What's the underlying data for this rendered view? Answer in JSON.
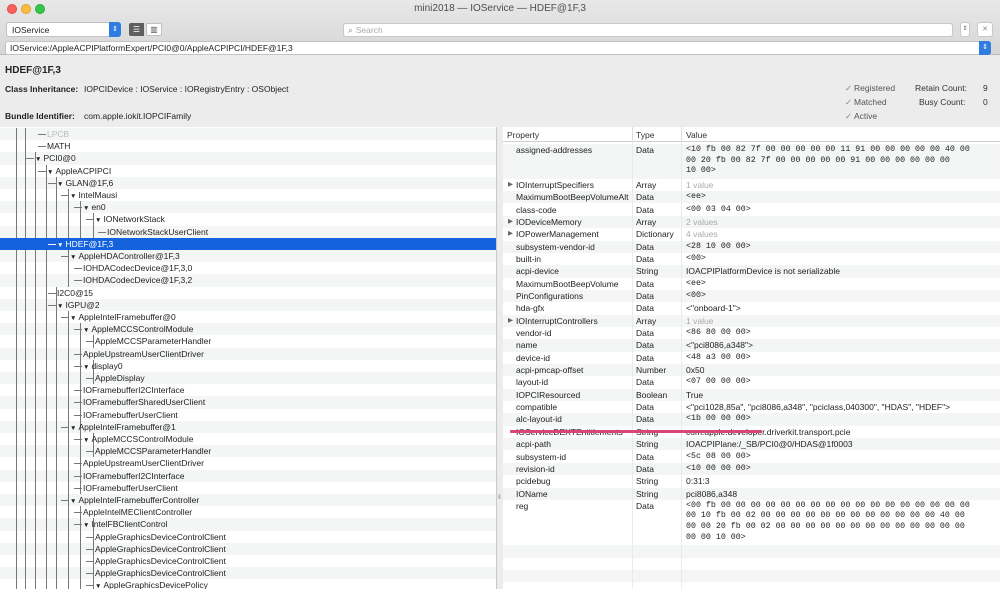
{
  "window": {
    "title": "mini2018 — IOService — HDEF@1F,3"
  },
  "toolbar": {
    "plane": "IOService",
    "search_placeholder": "Search",
    "search_icon": "magnifier-icon",
    "path": "IOService:/AppleACPIPlatformExpert/PCI0@0/AppleACPIPCI/HDEF@1F,3"
  },
  "info": {
    "name": "HDEF@1F,3",
    "class_label": "Class Inheritance:",
    "class_value": "IOPCIDevice : IOService : IORegistryEntry : OSObject",
    "bundle_label": "Bundle Identifier:",
    "bundle_value": "com.apple.iokit.IOPCIFamily",
    "registered": "Registered",
    "matched": "Matched",
    "active": "Active",
    "retain_label": "Retain Count:",
    "retain_value": "9",
    "busy_label": "Busy Count:",
    "busy_value": "0"
  },
  "tree": [
    {
      "label": "LPCB",
      "indent": 4,
      "arrow": "",
      "faded": true
    },
    {
      "label": "MATH",
      "indent": 4,
      "arrow": ""
    },
    {
      "label": "PCI0@0",
      "indent": 3,
      "arrow": "▼"
    },
    {
      "label": "AppleACPIPCI",
      "indent": 4,
      "arrow": "▼"
    },
    {
      "label": "GLAN@1F,6",
      "indent": 5,
      "arrow": "▼"
    },
    {
      "label": "IntelMausi",
      "indent": 6,
      "arrow": "▼"
    },
    {
      "label": "en0",
      "indent": 7,
      "arrow": "▼"
    },
    {
      "label": "IONetworkStack",
      "indent": 8,
      "arrow": "▼"
    },
    {
      "label": "IONetworkStackUserClient",
      "indent": 9,
      "arrow": ""
    },
    {
      "label": "HDEF@1F,3",
      "indent": 5,
      "arrow": "▼",
      "selected": true
    },
    {
      "label": "AppleHDAController@1F,3",
      "indent": 6,
      "arrow": "▼"
    },
    {
      "label": "IOHDACodecDevice@1F,3,0",
      "indent": 7,
      "arrow": ""
    },
    {
      "label": "IOHDACodecDevice@1F,3,2",
      "indent": 7,
      "arrow": ""
    },
    {
      "label": "I2C0@15",
      "indent": 5,
      "arrow": ""
    },
    {
      "label": "IGPU@2",
      "indent": 5,
      "arrow": "▼"
    },
    {
      "label": "AppleIntelFramebuffer@0",
      "indent": 6,
      "arrow": "▼"
    },
    {
      "label": "AppleMCCSControlModule",
      "indent": 7,
      "arrow": "▼"
    },
    {
      "label": "AppleMCCSParameterHandler",
      "indent": 8,
      "arrow": ""
    },
    {
      "label": "AppleUpstreamUserClientDriver",
      "indent": 7,
      "arrow": ""
    },
    {
      "label": "display0",
      "indent": 7,
      "arrow": "▼"
    },
    {
      "label": "AppleDisplay",
      "indent": 8,
      "arrow": ""
    },
    {
      "label": "IOFramebufferI2CInterface",
      "indent": 7,
      "arrow": ""
    },
    {
      "label": "IOFramebufferSharedUserClient",
      "indent": 7,
      "arrow": ""
    },
    {
      "label": "IOFramebufferUserClient",
      "indent": 7,
      "arrow": ""
    },
    {
      "label": "AppleIntelFramebuffer@1",
      "indent": 6,
      "arrow": "▼"
    },
    {
      "label": "AppleMCCSControlModule",
      "indent": 7,
      "arrow": "▼"
    },
    {
      "label": "AppleMCCSParameterHandler",
      "indent": 8,
      "arrow": ""
    },
    {
      "label": "AppleUpstreamUserClientDriver",
      "indent": 7,
      "arrow": ""
    },
    {
      "label": "IOFramebufferI2CInterface",
      "indent": 7,
      "arrow": ""
    },
    {
      "label": "IOFramebufferUserClient",
      "indent": 7,
      "arrow": ""
    },
    {
      "label": "AppleIntelFramebufferController",
      "indent": 6,
      "arrow": "▼"
    },
    {
      "label": "AppleIntelMEClientController",
      "indent": 7,
      "arrow": ""
    },
    {
      "label": "IntelFBClientControl",
      "indent": 7,
      "arrow": "▼"
    },
    {
      "label": "AppleGraphicsDeviceControlClient",
      "indent": 8,
      "arrow": ""
    },
    {
      "label": "AppleGraphicsDeviceControlClient",
      "indent": 8,
      "arrow": ""
    },
    {
      "label": "AppleGraphicsDeviceControlClient",
      "indent": 8,
      "arrow": ""
    },
    {
      "label": "AppleGraphicsDeviceControlClient",
      "indent": 8,
      "arrow": ""
    },
    {
      "label": "AppleGraphicsDevicePolicy",
      "indent": 8,
      "arrow": "▼"
    }
  ],
  "table": {
    "columns": [
      "Property",
      "Type",
      "Value"
    ],
    "rows": [
      {
        "prop": "assigned-addresses",
        "type": "Data",
        "value": [
          "<10 fb 00 82 7f 00 00 00 00 00 11 91 00 00 00 00 00 40 00",
          "00 20 fb 00 82 7f 00 00 00 00 00 91 00 00 00 00 00 00",
          "10 00>"
        ],
        "mono": true
      },
      {
        "prop": "IOInterruptSpecifiers",
        "type": "Array",
        "value": [
          "1 value"
        ],
        "expand": true,
        "grey": true
      },
      {
        "prop": "MaximumBootBeepVolumeAlt",
        "type": "Data",
        "value": [
          "<ee>"
        ],
        "mono": true
      },
      {
        "prop": "class-code",
        "type": "Data",
        "value": [
          "<00 03 04 00>"
        ],
        "mono": true
      },
      {
        "prop": "IODeviceMemory",
        "type": "Array",
        "value": [
          "2 values"
        ],
        "expand": true,
        "grey": true
      },
      {
        "prop": "IOPowerManagement",
        "type": "Dictionary",
        "value": [
          "4 values"
        ],
        "expand": true,
        "grey": true
      },
      {
        "prop": "subsystem-vendor-id",
        "type": "Data",
        "value": [
          "<28 10 00 00>"
        ],
        "mono": true
      },
      {
        "prop": "built-in",
        "type": "Data",
        "value": [
          "<00>"
        ],
        "mono": true
      },
      {
        "prop": "acpi-device",
        "type": "String",
        "value": [
          "IOACPIPlatformDevice is not serializable"
        ]
      },
      {
        "prop": "MaximumBootBeepVolume",
        "type": "Data",
        "value": [
          "<ee>"
        ],
        "mono": true
      },
      {
        "prop": "PinConfigurations",
        "type": "Data",
        "value": [
          "<00>"
        ],
        "mono": true
      },
      {
        "prop": "hda-gfx",
        "type": "Data",
        "value": [
          "<\"onboard-1\">"
        ]
      },
      {
        "prop": "IOInterruptControllers",
        "type": "Array",
        "value": [
          "1 value"
        ],
        "expand": true,
        "grey": true
      },
      {
        "prop": "vendor-id",
        "type": "Data",
        "value": [
          "<86 80 00 00>"
        ],
        "mono": true
      },
      {
        "prop": "name",
        "type": "Data",
        "value": [
          "<\"pci8086,a348\">"
        ]
      },
      {
        "prop": "device-id",
        "type": "Data",
        "value": [
          "<48 a3 00 00>"
        ],
        "mono": true
      },
      {
        "prop": "acpi-pmcap-offset",
        "type": "Number",
        "value": [
          "0x50"
        ]
      },
      {
        "prop": "layout-id",
        "type": "Data",
        "value": [
          "<07 00 00 00>"
        ],
        "mono": true
      },
      {
        "prop": "IOPCIResourced",
        "type": "Boolean",
        "value": [
          "True"
        ]
      },
      {
        "prop": "compatible",
        "type": "Data",
        "value": [
          "<\"pci1028,85a\", \"pci8086,a348\", \"pciclass,040300\", \"HDAS\", \"HDEF\">"
        ]
      },
      {
        "prop": "alc-layout-id",
        "type": "Data",
        "value": [
          "<1b 00 00 00>"
        ],
        "mono": true
      },
      {
        "prop": "IOServiceDEXTEntitlements",
        "type": "String",
        "value": [
          "com.apple.developer.driverkit.transport.pcie"
        ]
      },
      {
        "prop": "acpi-path",
        "type": "String",
        "value": [
          "IOACPIPlane:/_SB/PCI0@0/HDAS@1f0003"
        ]
      },
      {
        "prop": "subsystem-id",
        "type": "Data",
        "value": [
          "<5c 08 00 00>"
        ],
        "mono": true
      },
      {
        "prop": "revision-id",
        "type": "Data",
        "value": [
          "<10 00 00 00>"
        ],
        "mono": true
      },
      {
        "prop": "pcidebug",
        "type": "String",
        "value": [
          "0:31:3"
        ]
      },
      {
        "prop": "IOName",
        "type": "String",
        "value": [
          "pci8086,a348"
        ]
      },
      {
        "prop": "reg",
        "type": "Data",
        "value": [
          "<00 fb 00 00 00 00 00 00 00 00 00 00 00 00 00 00 00 00 00",
          "00 10 fb 00 02 00 00 00 00 00 00 00 00 00 00 00 00 40 00",
          "00 00 20 fb 00 02 00 00 00 00 00 00 00 00 00 00 00 00 00",
          "00 00 10 00>"
        ],
        "mono": true
      }
    ]
  },
  "colors": {
    "selection": "#1463dd",
    "annotation": "#d8457a",
    "traffic_close": "#fc605c",
    "traffic_min": "#fdbc40",
    "traffic_max": "#34c84a"
  }
}
